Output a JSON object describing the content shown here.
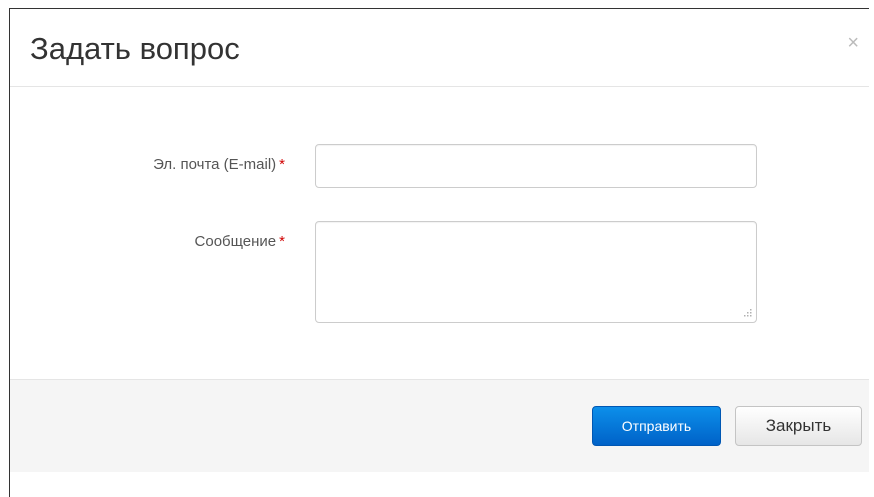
{
  "modal": {
    "title": "Задать вопрос",
    "close_symbol": "×"
  },
  "form": {
    "email": {
      "label": "Эл. почта (E-mail)",
      "required_mark": "*",
      "value": "",
      "placeholder": ""
    },
    "message": {
      "label": "Сообщение",
      "required_mark": "*",
      "value": "",
      "placeholder": ""
    }
  },
  "footer": {
    "submit_label": "Отправить",
    "close_label": "Закрыть"
  },
  "colors": {
    "primary_button": "#0a78dc",
    "required_mark": "#d00000",
    "footer_background": "#f5f5f5"
  },
  "icons": {
    "close": "close-icon",
    "resize_grip": "resize-grip-icon"
  }
}
